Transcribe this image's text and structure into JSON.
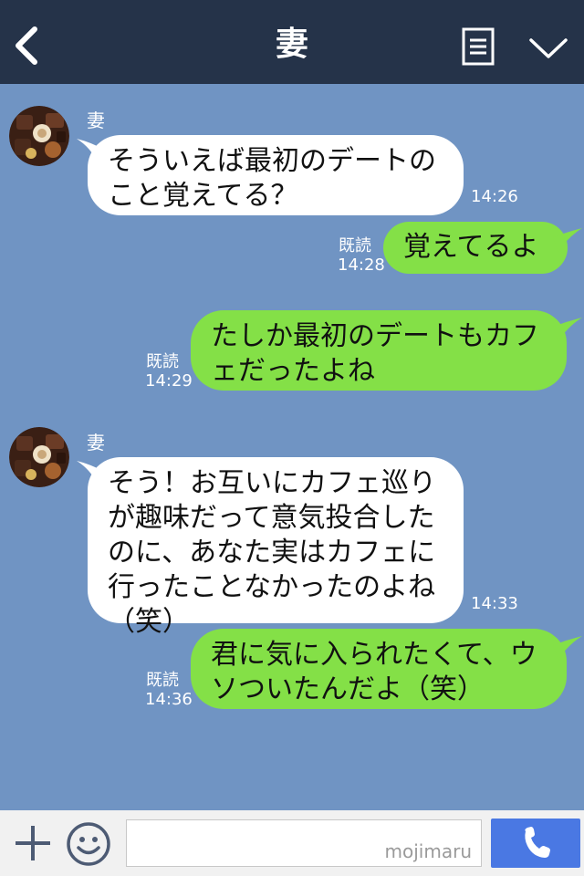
{
  "header": {
    "title": "妻",
    "icons": {
      "back": "chevron-left-icon",
      "menu": "notes-icon",
      "collapse": "chevron-down-icon"
    }
  },
  "messages": [
    {
      "direction": "in",
      "sender": "妻",
      "avatar": "chocolate-avatar",
      "text": "そういえば最初のデートの\nこと覚えてる？",
      "time": "14:26"
    },
    {
      "direction": "out",
      "text": "覚えてるよ",
      "read": "既読",
      "time": "14:28"
    },
    {
      "direction": "out",
      "text": "たしか最初のデートもカフ\nェだったよね",
      "read": "既読",
      "time": "14:29"
    },
    {
      "direction": "in",
      "sender": "妻",
      "avatar": "chocolate-avatar",
      "text": "そう！お互いにカフェ巡り\nが趣味だって意気投合した\nのに、あなた実はカフェに\n行ったことなかったのよね\n（笑）",
      "time": "14:33"
    },
    {
      "direction": "out",
      "text": "君に気に入られたくて、ウ\nソついたんだよ（笑）",
      "read": "既読",
      "time": "14:36"
    }
  ],
  "footer": {
    "input_value": "",
    "watermark": "mojimaru",
    "icons": {
      "plus": "plus-icon",
      "emoji": "smiley-icon",
      "call": "phone-icon"
    }
  },
  "colors": {
    "header_bg": "#253349",
    "chat_bg": "#7094c3",
    "incoming_bubble": "#ffffff",
    "outgoing_bubble": "#84e047",
    "call_button": "#4a78e3"
  }
}
